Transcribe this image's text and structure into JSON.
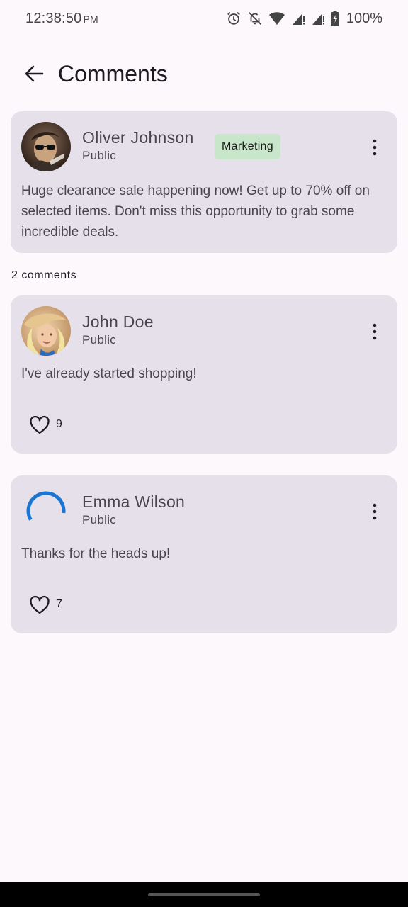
{
  "status_bar": {
    "time": "12:38:50",
    "ampm": "PM",
    "battery": "100%",
    "icons": [
      "alarm-icon",
      "notifications-off-icon",
      "wifi-icon",
      "signal-icon",
      "signal-icon",
      "battery-icon"
    ]
  },
  "header": {
    "title": "Comments",
    "back_icon": "arrow-left-icon"
  },
  "post": {
    "author": "Oliver Johnson",
    "visibility": "Public",
    "tag": "Marketing",
    "tag_color": "#c8e6c9",
    "body": "Huge clearance sale happening now! Get up to 70% off on selected items. Don't miss this opportunity to grab some incredible deals."
  },
  "comments_count_label": "2 comments",
  "comments": [
    {
      "author": "John Doe",
      "visibility": "Public",
      "body": "I've already started shopping!",
      "likes": "9"
    },
    {
      "author": "Emma Wilson",
      "visibility": "Public",
      "body": "Thanks for the heads up!",
      "likes": "7",
      "avatar_state": "loading"
    }
  ],
  "colors": {
    "card_bg": "#e6e0ea",
    "page_bg": "#fdf8fc",
    "spinner": "#1976d2"
  }
}
